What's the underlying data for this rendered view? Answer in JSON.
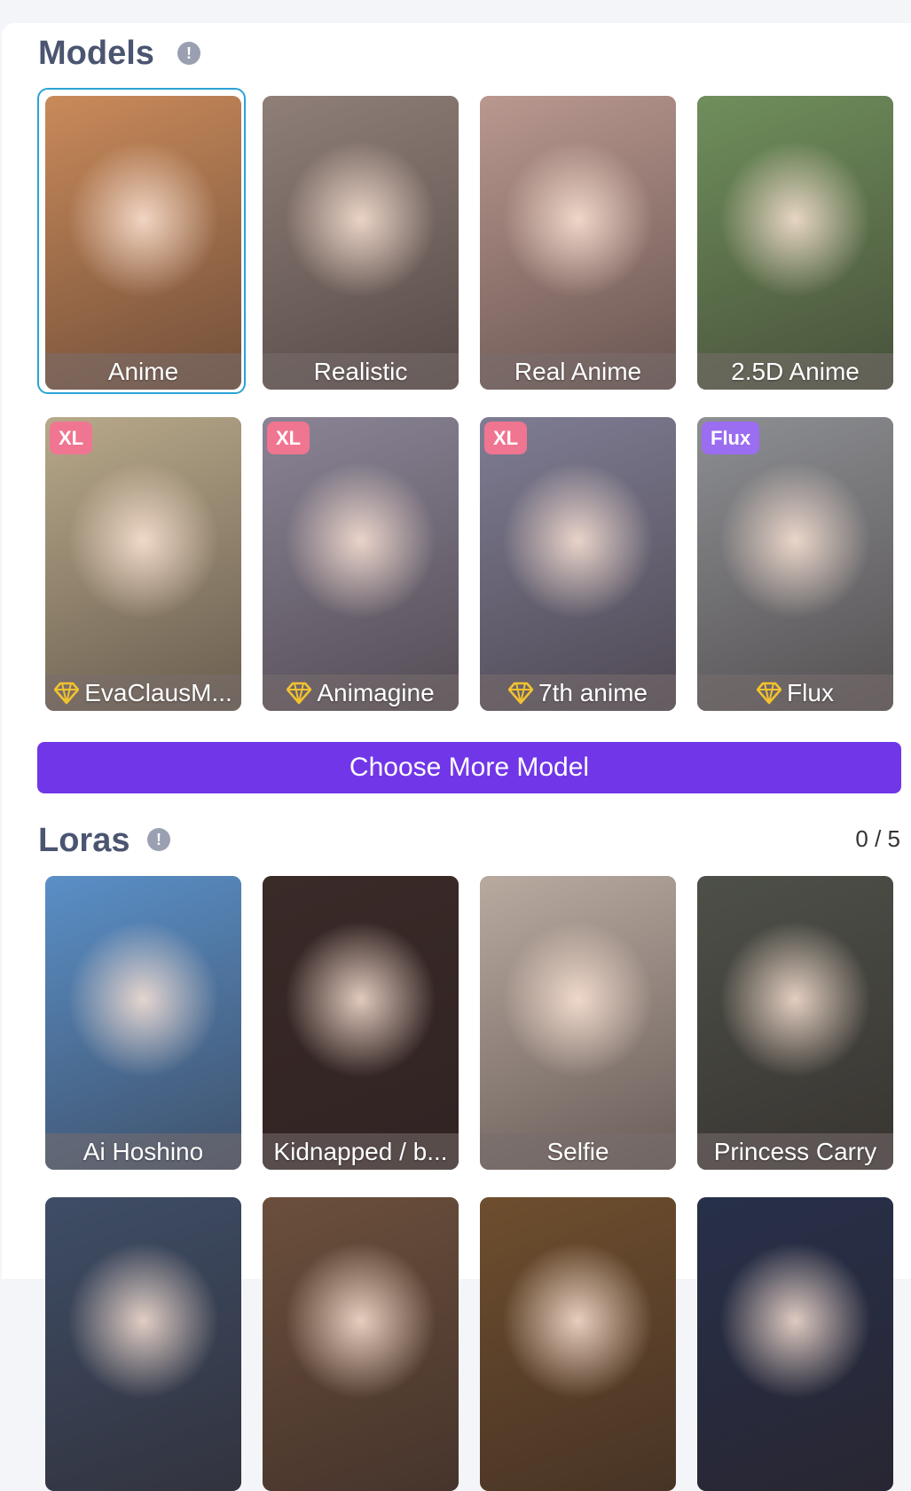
{
  "models": {
    "title": "Models",
    "info_icon": "info-icon",
    "items": [
      {
        "label": "Anime",
        "selected": true,
        "badge": "",
        "premium": false,
        "bg": "#c98a5a"
      },
      {
        "label": "Realistic",
        "selected": false,
        "badge": "",
        "premium": false,
        "bg": "#8f7f78"
      },
      {
        "label": "Real Anime",
        "selected": false,
        "badge": "",
        "premium": false,
        "bg": "#b9988f"
      },
      {
        "label": "2.5D Anime",
        "selected": false,
        "badge": "",
        "premium": false,
        "bg": "#6f8f5c"
      },
      {
        "label": "EvaClausM...",
        "selected": false,
        "badge": "XL",
        "premium": true,
        "bg": "#b8a98a"
      },
      {
        "label": "Animagine",
        "selected": false,
        "badge": "XL",
        "premium": true,
        "bg": "#8a8496"
      },
      {
        "label": "7th anime",
        "selected": false,
        "badge": "XL",
        "premium": true,
        "bg": "#7f7d94"
      },
      {
        "label": "Flux",
        "selected": false,
        "badge": "Flux",
        "premium": true,
        "bg": "#8d8f93"
      }
    ],
    "choose_more_label": "Choose More Model"
  },
  "loras": {
    "title": "Loras",
    "info_icon": "info-icon",
    "count": "0 / 5",
    "items": [
      {
        "label": "Ai Hoshino",
        "bg": "#5a8fc7"
      },
      {
        "label": "Kidnapped / b...",
        "bg": "#3a2a28"
      },
      {
        "label": "Selfie",
        "bg": "#b9aaa0"
      },
      {
        "label": "Princess Carry",
        "bg": "#4d5048"
      },
      {
        "label": "",
        "bg": "#3e4d66"
      },
      {
        "label": "",
        "bg": "#6b4f3c"
      },
      {
        "label": "",
        "bg": "#6e4e2e"
      },
      {
        "label": "",
        "bg": "#27304a"
      }
    ]
  },
  "colors": {
    "accent": "#7136e8",
    "selected_border": "#2aa3d6",
    "xl_badge": "#f07591",
    "flux_badge": "#9b6df0",
    "gem": "#f2c230"
  }
}
